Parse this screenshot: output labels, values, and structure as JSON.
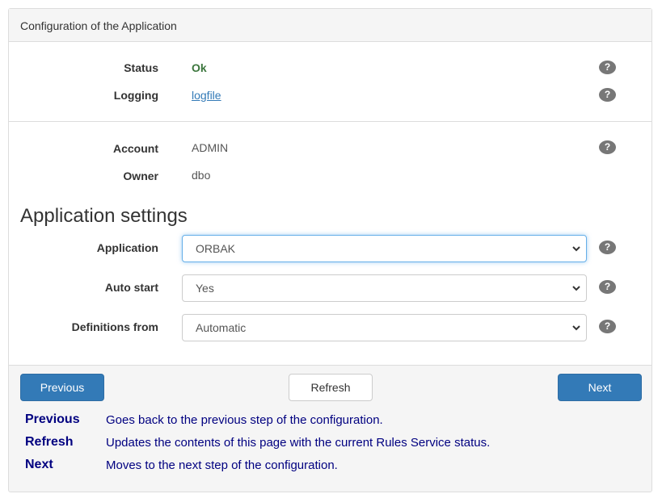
{
  "panel": {
    "title": "Configuration of the Application"
  },
  "status": {
    "status_label": "Status",
    "status_value": "Ok",
    "logging_label": "Logging",
    "logging_value": "logfile",
    "account_label": "Account",
    "account_value": "ADMIN",
    "owner_label": "Owner",
    "owner_value": "dbo",
    "help_glyph": "?"
  },
  "settings": {
    "title": "Application settings",
    "application_label": "Application",
    "application_value": "ORBAK",
    "auto_start_label": "Auto start",
    "auto_start_value": "Yes",
    "definitions_label": "Definitions from",
    "definitions_value": "Automatic"
  },
  "buttons": {
    "previous": "Previous",
    "refresh": "Refresh",
    "next": "Next"
  },
  "help": [
    {
      "key": "Previous",
      "desc": "Goes back to the previous step of the configuration."
    },
    {
      "key": "Refresh",
      "desc": "Updates the contents of this page with the current Rules Service status."
    },
    {
      "key": "Next",
      "desc": "Moves to the next step of the configuration."
    }
  ],
  "colors": {
    "primary": "#337ab7",
    "ok": "#3c763d",
    "help_text": "#000080",
    "help_badge": "#777777"
  },
  "icons": [
    "help-icon",
    "chevron-down-icon"
  ]
}
